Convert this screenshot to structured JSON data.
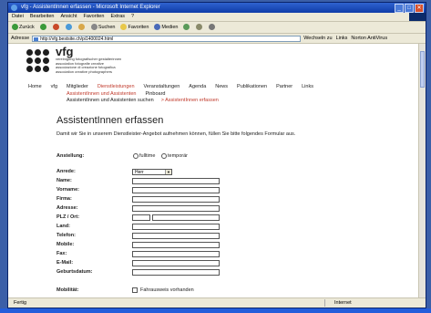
{
  "window": {
    "title": "vfg - AssistentInnen erfassen - Microsoft Internet Explorer",
    "buttons": [
      "_",
      "□",
      "✕"
    ]
  },
  "menu": [
    "Datei",
    "Bearbeiten",
    "Ansicht",
    "Favoriten",
    "Extras",
    "?"
  ],
  "toolbar": {
    "back": "Zurück",
    "search": "Suchen",
    "favorites": "Favoriten",
    "media": "Medien"
  },
  "address": {
    "label": "Adresse",
    "url": "http://vfg.bestsite.ch/pi1400024.html",
    "go": "Wechseln zu",
    "links": "Links",
    "norton": "Norton AntiVirus"
  },
  "site": {
    "name": "vfg",
    "tagline": [
      "vereinigung fotografischer gestalterinnen",
      "association fotografie creative",
      "associazione di creazione fotografica",
      "association creative photographers"
    ],
    "nav": [
      "Home",
      "vfg",
      "Mitglieder",
      "Dienstleistungen",
      "Veranstaltungen",
      "Agenda",
      "News",
      "Publikationen",
      "Partner",
      "Links"
    ],
    "sub1": [
      "AssistentInnen und Assistenten",
      "Pinboard"
    ],
    "sub2": [
      "AssistentInnen und Assistenten suchen",
      "> AssistentInnen erfassen"
    ]
  },
  "form": {
    "heading": "AssistentInnen erfassen",
    "intro": "Damit wir Sie in unserem Dienstleister-Angebot aufnehmen können, füllen Sie bitte folgendes Formular aus.",
    "anstellung_label": "Anstellung:",
    "anstellung_options": [
      "fulltime",
      "temporär"
    ],
    "anrede_label": "Anrede:",
    "anrede_value": "Herr",
    "fields": [
      "Name:",
      "Vorname:",
      "Firma:",
      "Adresse:",
      "PLZ / Ort:",
      "Land:",
      "Telefon:",
      "Mobile:",
      "Fax:",
      "E-Mail:",
      "Geburtsdatum:"
    ],
    "mobilitaet_label": "Mobilität:",
    "mobilitaet_option": "Fahrausweis vorhanden"
  },
  "status": {
    "left": "Fertig",
    "zone": "Internet"
  }
}
